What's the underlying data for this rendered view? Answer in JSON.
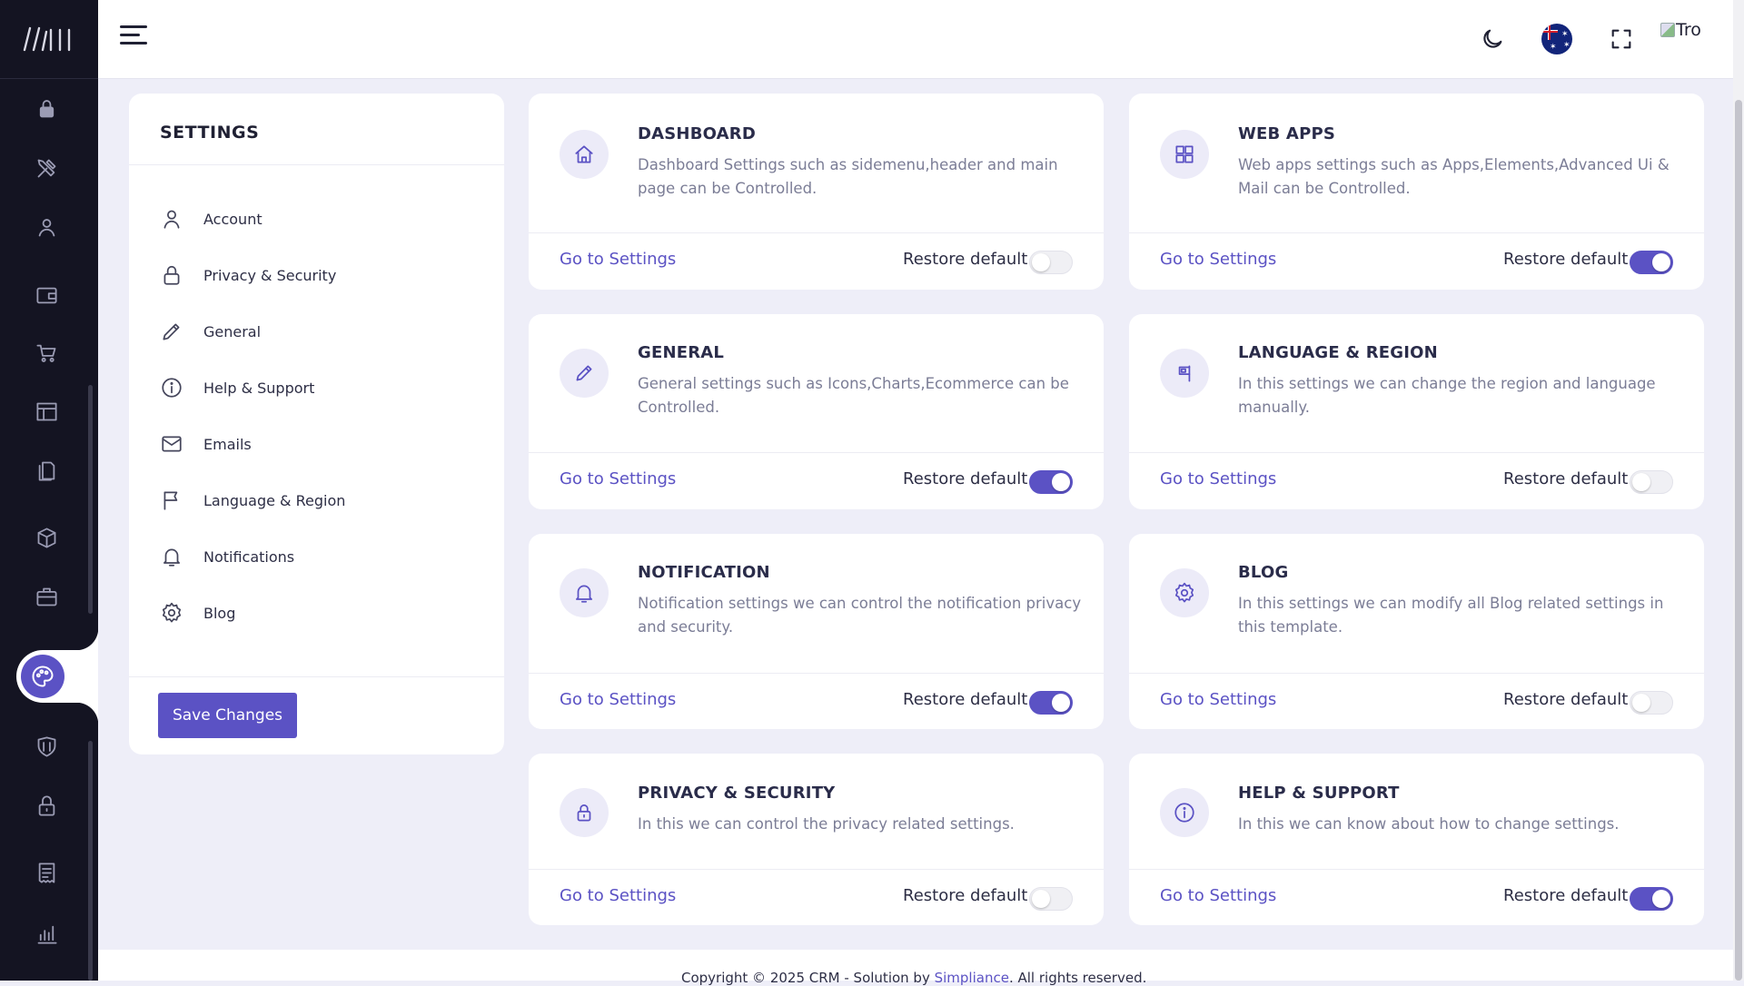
{
  "header": {
    "avatar_alt": "Tro"
  },
  "settings_panel": {
    "title": "SETTINGS",
    "items": [
      {
        "label": "Account",
        "icon": "user-icon"
      },
      {
        "label": "Privacy & Security",
        "icon": "lock-icon"
      },
      {
        "label": "General",
        "icon": "pencil-icon"
      },
      {
        "label": "Help & Support",
        "icon": "info-icon"
      },
      {
        "label": "Emails",
        "icon": "mail-icon"
      },
      {
        "label": "Language & Region",
        "icon": "flag-icon"
      },
      {
        "label": "Notifications",
        "icon": "bell-icon"
      },
      {
        "label": "Blog",
        "icon": "gear-icon"
      }
    ],
    "save_label": "Save Changes"
  },
  "cards": [
    {
      "title": "DASHBOARD",
      "desc": "Dashboard Settings such as sidemenu,header and main page can be Controlled.",
      "goto": "Go to Settings",
      "restore": "Restore default",
      "restore_on": false,
      "icon": "home-icon"
    },
    {
      "title": "WEB APPS",
      "desc": "Web apps settings such as Apps,Elements,Advanced Ui & Mail can be Controlled.",
      "goto": "Go to Settings",
      "restore": "Restore default",
      "restore_on": true,
      "icon": "grid-icon"
    },
    {
      "title": "GENERAL",
      "desc": "General settings such as Icons,Charts,Ecommerce can be Controlled.",
      "goto": "Go to Settings",
      "restore": "Restore default",
      "restore_on": true,
      "icon": "pencil-icon"
    },
    {
      "title": "LANGUAGE & REGION",
      "desc": "In this settings we can change the region and language manually.",
      "goto": "Go to Settings",
      "restore": "Restore default",
      "restore_on": false,
      "icon": "flag-icon"
    },
    {
      "title": "NOTIFICATION",
      "desc": "Notification settings we can control the notification privacy and security.",
      "goto": "Go to Settings",
      "restore": "Restore default",
      "restore_on": true,
      "icon": "bell-icon"
    },
    {
      "title": "BLOG",
      "desc": "In this settings we can modify all Blog related settings in this template.",
      "goto": "Go to Settings",
      "restore": "Restore default",
      "restore_on": false,
      "icon": "gear-icon"
    },
    {
      "title": "PRIVACY & SECURITY",
      "desc": "In this we can control the privacy related settings.",
      "goto": "Go to Settings",
      "restore": "Restore default",
      "restore_on": false,
      "icon": "lock-icon"
    },
    {
      "title": "HELP & SUPPORT",
      "desc": "In this we can know about how to change settings.",
      "goto": "Go to Settings",
      "restore": "Restore default",
      "restore_on": true,
      "icon": "info-icon"
    }
  ],
  "footer": {
    "prefix": "Copyright © 2025 CRM - Solution by ",
    "link": "Simpliance",
    "suffix": ". All rights reserved."
  },
  "colors": {
    "accent": "#5b52c4",
    "rail": "#141422",
    "page_bg": "#eeeef8"
  }
}
